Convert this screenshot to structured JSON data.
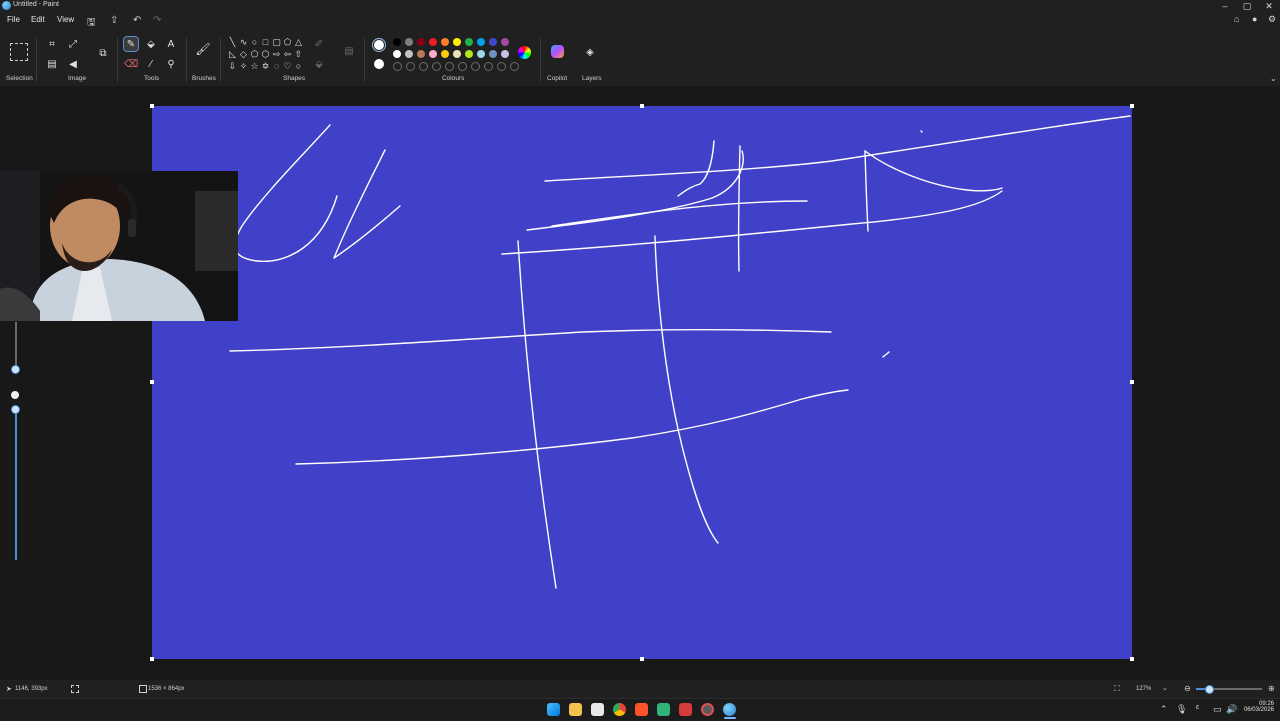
{
  "window": {
    "title": "Untitled - Paint",
    "controls": {
      "minimize": "–",
      "maximize": "▢",
      "close": "✕"
    }
  },
  "menu": {
    "items": [
      "File",
      "Edit",
      "View"
    ]
  },
  "ribbon": {
    "groups": {
      "selection": "Selection",
      "image": "Image",
      "tools": "Tools",
      "brushes": "Brushes",
      "shapes": "Shapes",
      "colours": "Colours",
      "copilot": "Copilot",
      "layers": "Layers"
    },
    "text_tool_glyph": "A",
    "colour_swatches": [
      "#000000",
      "#7f7f7f",
      "#880015",
      "#ed1c24",
      "#ff7f27",
      "#fff200",
      "#22b14c",
      "#00a2e8",
      "#3f48cc",
      "#a349a4"
    ],
    "colour_swatches_row2": [
      "#ffffff",
      "#c3c3c3",
      "#b97a57",
      "#ffaec9",
      "#ffc90e",
      "#efe4b0",
      "#b5e61d",
      "#99d9ea",
      "#7092be",
      "#c8bfe7"
    ],
    "primary_colour": "#ffffff",
    "secondary_colour": "#ffffff"
  },
  "canvas": {
    "background": "#4040c8",
    "stroke_colour": "#ffffff"
  },
  "status": {
    "cursor_position": "1146, 393px",
    "canvas_size": "1536 × 864px",
    "zoom": "127%"
  },
  "taskbar": {
    "time": "09:26",
    "date": "06/03/2026",
    "apps": [
      "windows-start",
      "file-explorer",
      "calendar-app",
      "chrome",
      "brave",
      "terminal-app",
      "paint-red",
      "settings",
      "paint-active"
    ]
  }
}
